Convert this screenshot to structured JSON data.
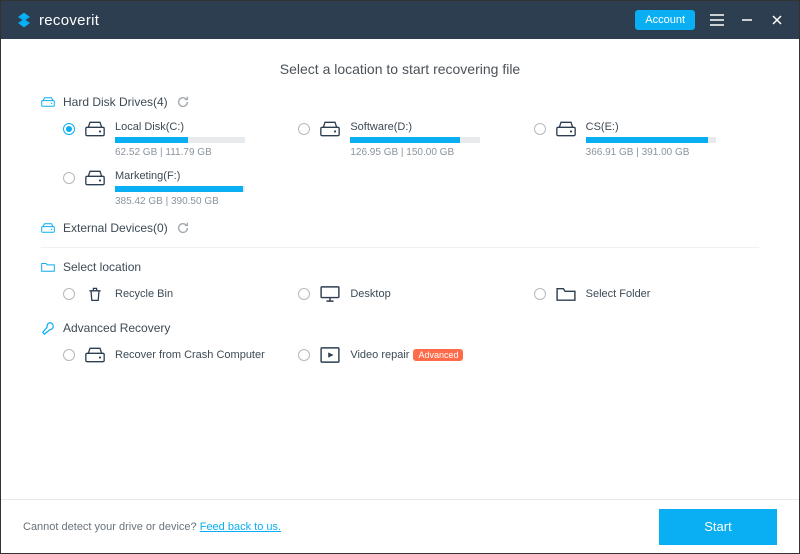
{
  "brand": "recoverit",
  "accountBtn": "Account",
  "heading": "Select a location to start recovering file",
  "sections": {
    "hdd": {
      "title": "Hard Disk Drives(4)",
      "drives": [
        {
          "label": "Local Disk(C:)",
          "used": 62.52,
          "total": 111.79,
          "size": "62.52  GB | 111.79  GB",
          "selected": true
        },
        {
          "label": "Software(D:)",
          "used": 126.95,
          "total": 150.0,
          "size": "126.95  GB | 150.00  GB",
          "selected": false
        },
        {
          "label": "CS(E:)",
          "used": 366.91,
          "total": 391.0,
          "size": "366.91  GB | 391.00  GB",
          "selected": false
        },
        {
          "label": "Marketing(F:)",
          "used": 385.42,
          "total": 390.5,
          "size": "385.42  GB | 390.50  GB",
          "selected": false
        }
      ]
    },
    "external": {
      "title": "External Devices(0)"
    },
    "select": {
      "title": "Select location",
      "items": [
        {
          "label": "Recycle Bin",
          "icon": "recycle"
        },
        {
          "label": "Desktop",
          "icon": "desktop"
        },
        {
          "label": "Select Folder",
          "icon": "folder"
        }
      ]
    },
    "advanced": {
      "title": "Advanced Recovery",
      "items": [
        {
          "label": "Recover from Crash Computer",
          "icon": "drive",
          "badge": null
        },
        {
          "label": "Video repair",
          "icon": "video",
          "badge": "Advanced"
        }
      ]
    }
  },
  "footer": {
    "text": "Cannot detect your drive or device? ",
    "link": "Feed back to us.",
    "start": "Start"
  },
  "colors": {
    "accent": "#0aaef2",
    "titlebar": "#2d3e50"
  }
}
